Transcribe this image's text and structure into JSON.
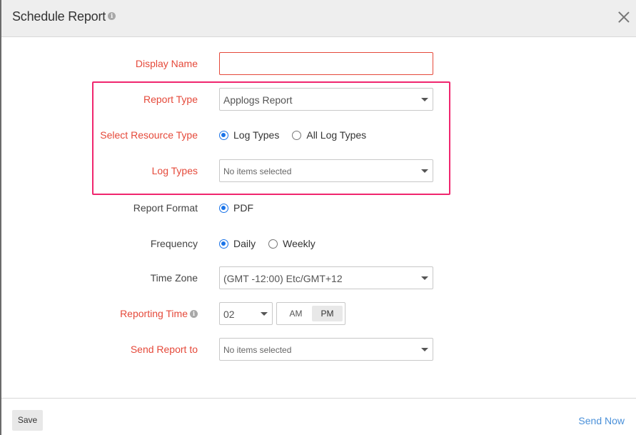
{
  "dialog": {
    "title": "Schedule Report",
    "title_info_icon": "info-icon",
    "close_icon": "close-icon"
  },
  "form": {
    "display_name": {
      "label": "Display Name",
      "value": "",
      "placeholder": "",
      "required": true
    },
    "report_type": {
      "label": "Report Type",
      "value": "Applogs Report",
      "required": true
    },
    "resource_type": {
      "label": "Select Resource Type",
      "required": true,
      "options": [
        {
          "label": "Log Types",
          "selected": true
        },
        {
          "label": "All Log Types",
          "selected": false
        }
      ]
    },
    "log_types": {
      "label": "Log Types",
      "value": "No items selected",
      "required": true
    },
    "report_format": {
      "label": "Report Format",
      "options": [
        {
          "label": "PDF",
          "selected": true
        }
      ]
    },
    "frequency": {
      "label": "Frequency",
      "options": [
        {
          "label": "Daily",
          "selected": true
        },
        {
          "label": "Weekly",
          "selected": false
        }
      ]
    },
    "time_zone": {
      "label": "Time Zone",
      "value": "(GMT -12:00) Etc/GMT+12"
    },
    "reporting_time": {
      "label": "Reporting Time",
      "required": true,
      "hour": "02",
      "am_label": "AM",
      "pm_label": "PM",
      "selected_period": "PM"
    },
    "send_report_to": {
      "label": "Send Report to",
      "value": "No items selected",
      "required": true
    }
  },
  "footer": {
    "save_label": "Save",
    "send_now_label": "Send Now"
  },
  "colors": {
    "required_label": "#e5493a",
    "highlight_border": "#f0266e",
    "radio_accent": "#1a73e8",
    "link": "#4a90d9"
  }
}
